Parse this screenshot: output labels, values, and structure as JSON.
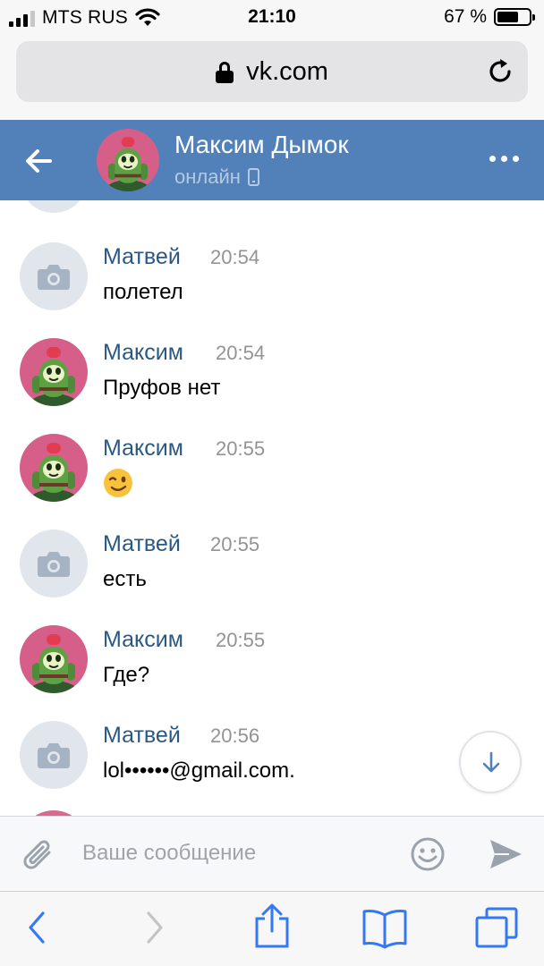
{
  "status_bar": {
    "carrier": "MTS RUS",
    "time": "21:10",
    "battery": "67 %",
    "battery_level": 0.67
  },
  "address_bar": {
    "url": "vk.com"
  },
  "chat_header": {
    "name": "Максим Дымок",
    "status": "онлайн"
  },
  "messages": [
    {
      "author": "Матвей",
      "time": "20:54",
      "text": "полетел",
      "avatar": "camera-placeholder"
    },
    {
      "author": "Максим",
      "time": "20:54",
      "text": "Пруфов нет",
      "avatar": "cactus-avatar"
    },
    {
      "author": "Максим",
      "time": "20:55",
      "text": "",
      "emoji": "winking-face-emoji",
      "avatar": "cactus-avatar"
    },
    {
      "author": "Матвей",
      "time": "20:55",
      "text": "есть",
      "avatar": "camera-placeholder"
    },
    {
      "author": "Максим",
      "time": "20:55",
      "text": "Где?",
      "avatar": "cactus-avatar"
    },
    {
      "author": "Матвей",
      "time": "20:56",
      "text": "lol••••••@gmail.com.",
      "avatar": "camera-placeholder"
    }
  ],
  "composer": {
    "placeholder": "Ваше сообщение",
    "value": ""
  },
  "colors": {
    "header": "#5181b8",
    "author": "#2a5885",
    "time": "#939393",
    "accent": "#3f8ae0"
  }
}
